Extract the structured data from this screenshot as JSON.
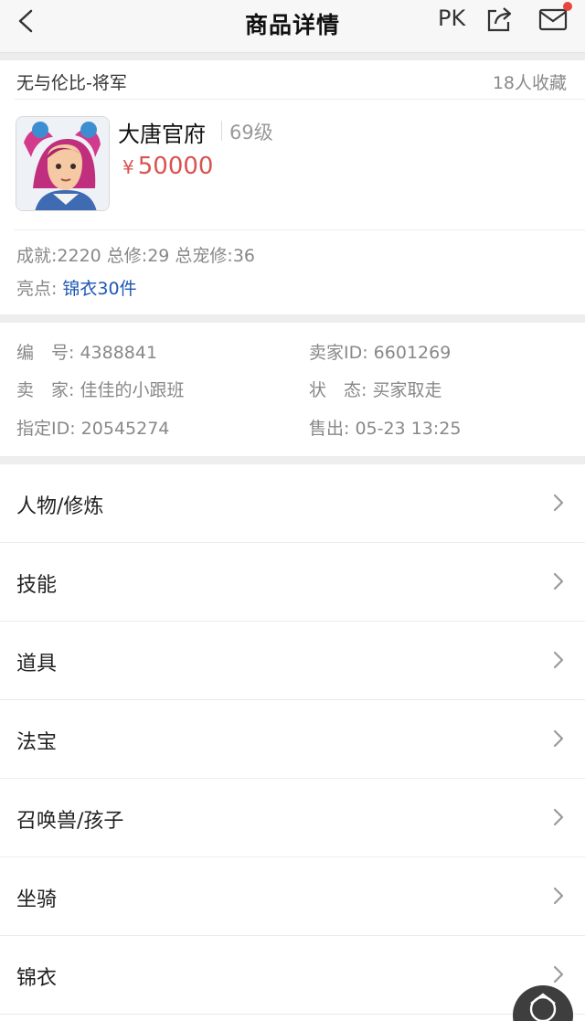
{
  "header": {
    "title": "商品详情",
    "pk_label": "PK"
  },
  "item": {
    "breadcrumb": "无与伦比-将军",
    "fav_count": "18人收藏",
    "school": "大唐官府",
    "level": "69级",
    "price_symbol": "¥",
    "price": "50000",
    "stats": "成就:2220 总修:29 总宠修:36",
    "highlight_label": "亮点:",
    "highlight_value": "锦衣30件"
  },
  "info": {
    "id": "编　号: 4388841",
    "seller_id": "卖家ID: 6601269",
    "seller": "卖　家: 佳佳的小跟班",
    "status": "状　态: 买家取走",
    "designated_id": "指定ID: 20545274",
    "sold": "售出: 05-23 13:25"
  },
  "menu": [
    {
      "label": "人物/修炼"
    },
    {
      "label": "技能"
    },
    {
      "label": "道具"
    },
    {
      "label": "法宝"
    },
    {
      "label": "召唤兽/孩子"
    },
    {
      "label": "坐骑"
    },
    {
      "label": "锦衣"
    }
  ],
  "colors": {
    "price": "#d9534f",
    "highlight": "#1e56b3",
    "badge": "#e9453c"
  }
}
